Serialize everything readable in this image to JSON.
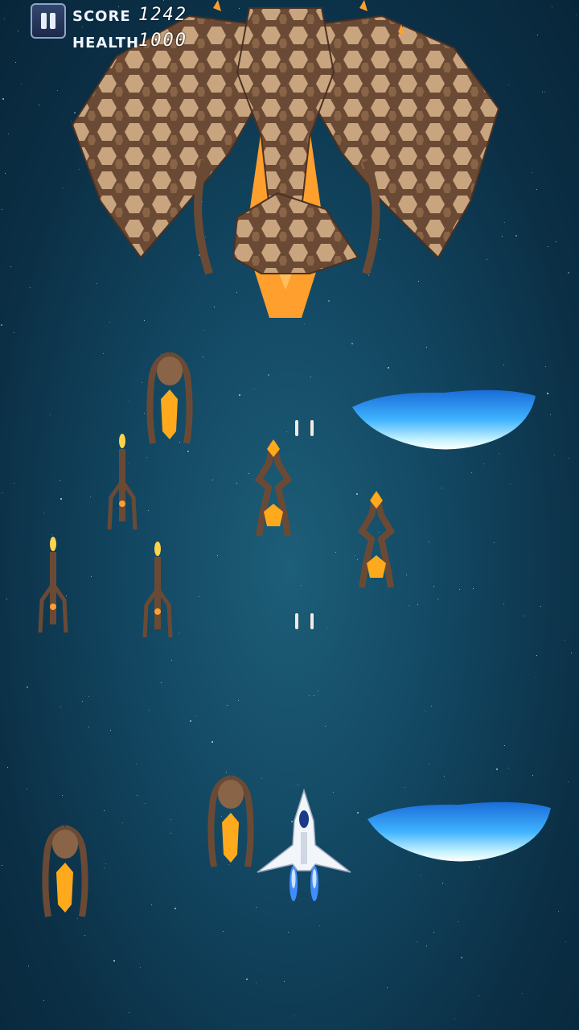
{
  "hud": {
    "score_label": "SCORE",
    "score_value": "1242",
    "health_label": "HEALTH",
    "health_value": "1000"
  },
  "icons": {
    "pause": "pause-icon"
  },
  "colors": {
    "background": "#124661",
    "alien_brown": "#6b4a35",
    "alien_tan": "#c9a57f",
    "glow_orange": "#ff9f2e",
    "shield_blue": "#3fb3ff",
    "player_white": "#f2f5fa",
    "engine_blue": "#3f8cff"
  }
}
